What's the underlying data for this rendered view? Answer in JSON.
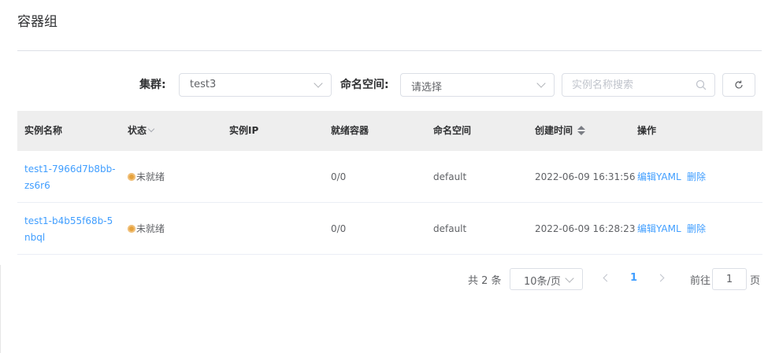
{
  "page": {
    "title": "容器组"
  },
  "filters": {
    "cluster_label": "集群:",
    "cluster_value": "test3",
    "namespace_label": "命名空间:",
    "namespace_placeholder": "请选择",
    "search_placeholder": "实例名称搜索"
  },
  "table": {
    "headers": {
      "name": "实例名称",
      "status": "状态",
      "ip": "实例IP",
      "ready": "就绪容器",
      "namespace": "命名空间",
      "created": "创建时间",
      "actions": "操作"
    },
    "rows": [
      {
        "name": "test1-7966d7b8bb-zs6r6",
        "status": "未就绪",
        "ip": "",
        "ready": "0/0",
        "namespace": "default",
        "created": "2022-06-09 16:31:56",
        "edit": "编辑YAML",
        "delete": "删除"
      },
      {
        "name": "test1-b4b55f68b-5nbql",
        "status": "未就绪",
        "ip": "",
        "ready": "0/0",
        "namespace": "default",
        "created": "2022-06-09 16:28:23",
        "edit": "编辑YAML",
        "delete": "删除"
      }
    ]
  },
  "pagination": {
    "total": "共 2 条",
    "page_size": "10条/页",
    "current_page": "1",
    "goto_label": "前往",
    "goto_value": "1",
    "page_word": "页"
  },
  "colors": {
    "link": "#409eff",
    "status_warning": "#e6a23c",
    "header_bg": "#eeeeee"
  }
}
